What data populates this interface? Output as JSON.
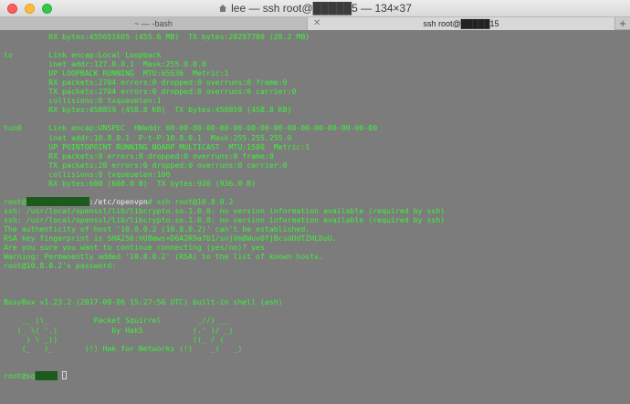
{
  "window": {
    "title": "lee — ssh root@█████5 — 134×37"
  },
  "tabs": [
    {
      "label": "~ — -bash"
    },
    {
      "label": "ssh root@█████15"
    }
  ],
  "new_tab_label": "+",
  "terminal": {
    "lines": [
      {
        "text": "          RX bytes:455651605 (455.6 MB)  TX bytes:20297780 (20.2 MB)"
      },
      {
        "text": ""
      },
      {
        "text": "lo        Link encap:Local Loopback"
      },
      {
        "text": "          inet addr:127.0.0.1  Mask:255.0.0.0"
      },
      {
        "text": "          UP LOOPBACK RUNNING  MTU:65536  Metric:1"
      },
      {
        "text": "          RX packets:2704 errors:0 dropped:0 overruns:0 frame:0"
      },
      {
        "text": "          TX packets:2704 errors:0 dropped:0 overruns:0 carrier:0"
      },
      {
        "text": "          collisions:0 txqueuelen:1"
      },
      {
        "text": "          RX bytes:458859 (458.8 KB)  TX bytes:458859 (458.8 KB)"
      },
      {
        "text": ""
      },
      {
        "text": "tun0      Link encap:UNSPEC  HWaddr 00-00-00-00-00-00-00-00-00-00-00-00-00-00-00-00"
      },
      {
        "text": "          inet addr:10.8.0.1  P-t-P:10.8.0.1  Mask:255.255.255.0"
      },
      {
        "text": "          UP POINTOPOINT RUNNING NOARP MULTICAST  MTU:1500  Metric:1"
      },
      {
        "text": "          RX packets:8 errors:0 dropped:0 overruns:0 frame:0"
      },
      {
        "text": "          TX packets:28 errors:0 dropped:0 overruns:0 carrier:0"
      },
      {
        "text": "          collisions:0 txqueuelen:100"
      },
      {
        "text": "          RX bytes:608 (608.0 B)  TX bytes:936 (936.0 B)"
      },
      {
        "text": ""
      },
      {
        "segments": [
          {
            "text": "root@",
            "style": "green"
          },
          {
            "text": "7█████████████",
            "style": "redact"
          },
          {
            "text": ":/etc/openvpn",
            "style": "white"
          },
          {
            "text": "# ssh root@10.8.0.2",
            "style": "green"
          }
        ]
      },
      {
        "text": "ssh: /usr/local/openssl/lib/libcrypto.so.1.0.0: no version information available (required by ssh)"
      },
      {
        "text": "ssh: /usr/local/openssl/lib/libcrypto.so.1.0.0: no version information available (required by ssh)"
      },
      {
        "text": "The authenticity of host '10.8.0.2 (10.8.0.2)' can't be established."
      },
      {
        "text": "RSA key fingerprint is SHA256:hU8mws+D6A2R9a7b1/snjVm8Wuv0fjBcsdOdTZHLDuU."
      },
      {
        "text": "Are you sure you want to continue connecting (yes/no)? yes"
      },
      {
        "text": "Warning: Permanently added '10.8.0.2' (RSA) to the list of known hosts."
      },
      {
        "text": "root@10.8.0.2's password:"
      },
      {
        "text": ""
      },
      {
        "text": ""
      },
      {
        "text": ""
      },
      {
        "text": "BusyBox v1.23.2 (2017-09-06 15:27:56 UTC) built-in shell (ash)"
      },
      {
        "text": ""
      },
      {
        "text": "    __ (\\_          Packet Squirrel        _//) __"
      },
      {
        "text": "   (_ \\( '.)            by Hak5           (.' )/ _)"
      },
      {
        "text": "     ) \\ _))                              ((_ / ("
      },
      {
        "text": "    (_   )_       (!) Hak for Networks (!)    _(   _)"
      },
      {
        "text": ""
      },
      {
        "text": ""
      },
      {
        "segments": [
          {
            "text": "root@sq",
            "style": "green"
          },
          {
            "text": "██:~#",
            "style": "redact"
          },
          {
            "text": " ",
            "style": "green"
          }
        ],
        "cursor": true
      }
    ]
  }
}
